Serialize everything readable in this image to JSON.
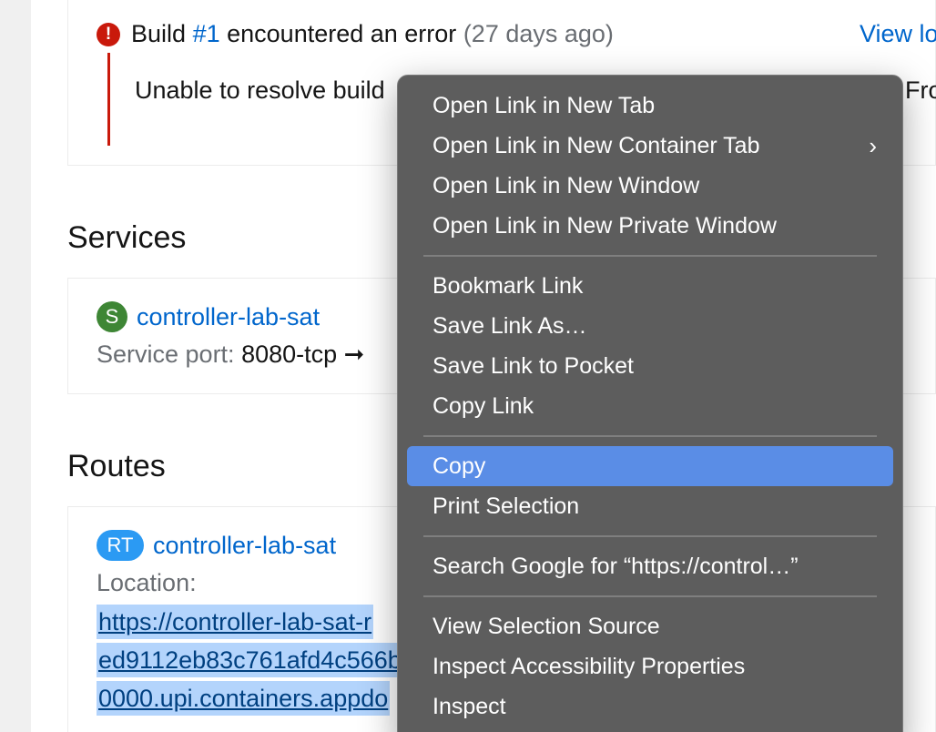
{
  "build": {
    "label_pre": "Build",
    "number": "#1",
    "label_post": "encountered an error",
    "age": "(27 days ago)",
    "view_logs": "View lo",
    "message": "Unable to resolve build",
    "message_tail": "Fro"
  },
  "services": {
    "heading": "Services",
    "badge": "S",
    "name": "controller-lab-sat",
    "port_label": "Service port:",
    "port_value": "8080-tcp",
    "arrow": "➞"
  },
  "routes": {
    "heading": "Routes",
    "badge": "RT",
    "name": "controller-lab-sat",
    "location_label": "Location:",
    "url_lines": [
      "https://controller-lab-sat-r",
      "ed9112eb83c761afd4c566b",
      "0000.upi.containers.appdo"
    ]
  },
  "context_menu": {
    "groups": [
      [
        {
          "label": "Open Link in New Tab"
        },
        {
          "label": "Open Link in New Container Tab",
          "submenu": "›"
        },
        {
          "label": "Open Link in New Window"
        },
        {
          "label": "Open Link in New Private Window"
        }
      ],
      [
        {
          "label": "Bookmark Link"
        },
        {
          "label": "Save Link As…"
        },
        {
          "label": "Save Link to Pocket"
        },
        {
          "label": "Copy Link"
        }
      ],
      [
        {
          "label": "Copy",
          "active": true
        },
        {
          "label": "Print Selection"
        }
      ],
      [
        {
          "label": "Search Google for “https://control…”"
        }
      ],
      [
        {
          "label": "View Selection Source"
        },
        {
          "label": "Inspect Accessibility Properties"
        },
        {
          "label": "Inspect"
        }
      ]
    ]
  },
  "colors": {
    "error": "#c9190b",
    "link": "#0066cc",
    "menu_bg": "#5d5d5d",
    "menu_highlight": "#5a8de6",
    "selection": "#b3d4fc"
  }
}
